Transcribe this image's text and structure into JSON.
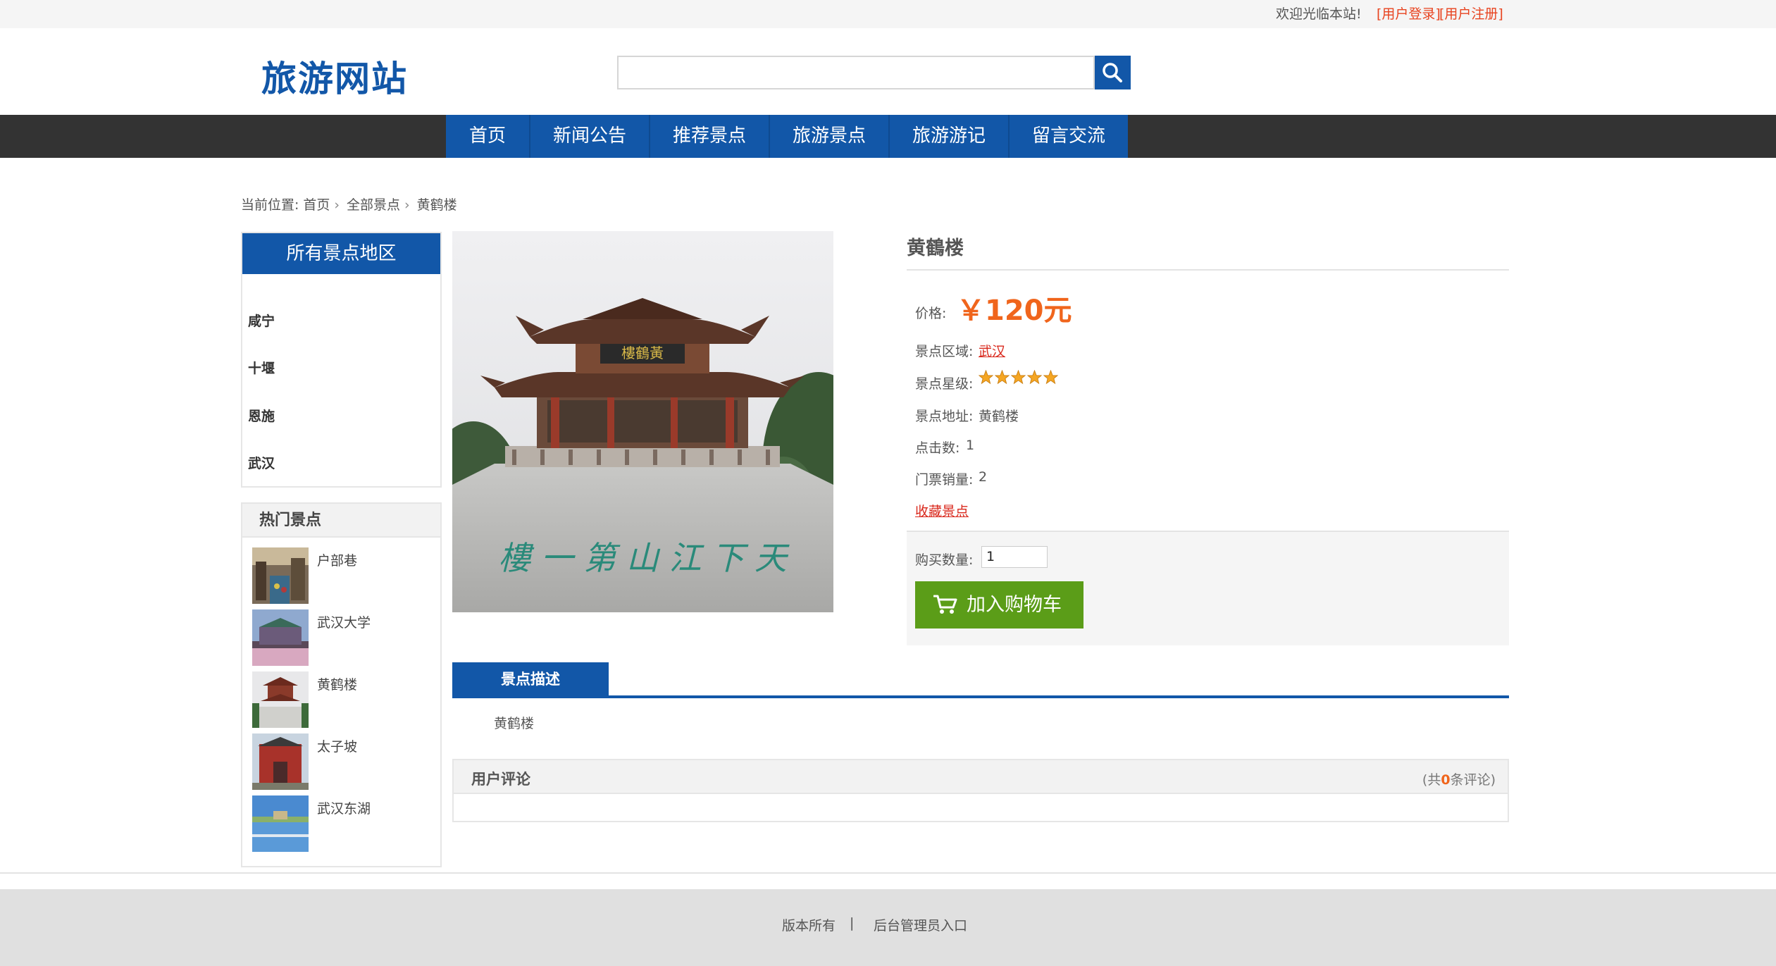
{
  "topbar": {
    "welcome": "欢迎光临本站!",
    "login": "[用户登录]",
    "register": "[用户注册]"
  },
  "header": {
    "logo": "旅游网站",
    "search_value": ""
  },
  "nav": {
    "items": [
      "首页",
      "新闻公告",
      "推荐景点",
      "旅游景点",
      "旅游游记",
      "留言交流"
    ]
  },
  "breadcrumb": {
    "prefix": "当前位置:",
    "home": "首页",
    "all": "全部景点",
    "current": "黄鹤楼"
  },
  "sidebar": {
    "region_title": "所有景点地区",
    "regions": [
      "咸宁",
      "十堰",
      "恩施",
      "武汉"
    ],
    "hot_title": "热门景点",
    "hot_items": [
      "户部巷",
      "武汉大学",
      "黄鹤楼",
      "太子坡",
      "武汉东湖"
    ]
  },
  "detail": {
    "title": "黄鶴楼",
    "price_label": "价格:",
    "price": "￥120元",
    "area_label": "景点区域:",
    "area": "武汉",
    "star_label": "景点星级:",
    "stars": 5,
    "addr_label": "景点地址:",
    "addr": "黄鹤楼",
    "click_label": "点击数:",
    "clicks": "1",
    "sales_label": "门票销量:",
    "sales": "2",
    "favorite": "收藏景点",
    "qty_label": "购买数量:",
    "qty": "1",
    "cart_button": "加入购物车"
  },
  "description": {
    "tab": "景点描述",
    "text": "黄鹤楼"
  },
  "reviews": {
    "title": "用户评论",
    "count_prefix": "(共",
    "count": "0",
    "count_suffix": "条评论)"
  },
  "footer": {
    "copyright": "版本所有",
    "divider": "|",
    "admin": "后台管理员入口"
  },
  "colors": {
    "brand_blue": "#1257a8",
    "price_orange": "#f0651c",
    "cart_green": "#5b9d18",
    "link_red": "#d9281c"
  }
}
